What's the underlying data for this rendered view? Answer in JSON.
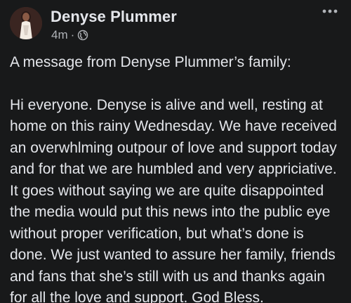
{
  "post": {
    "author_name": "Denyse Plummer",
    "time_ago": "4m",
    "separator": "·",
    "audience_icon": "globe-icon",
    "more_icon": "more-options-icon",
    "intro": "A message from Denyse Plummer’s family:",
    "message": "Hi everyone. Denyse is alive and well, resting at home on this rainy Wednesday. We have received an overwhlming outpour of love and support today and for that we are humbled and very appriciative. It goes without saying we are quite disappointed the media would put this news into the public eye without proper verification, but what’s done is done. We just wanted to assure her family, friends and fans that she’s still with us and thanks again for all the love and support. God Bless."
  },
  "colors": {
    "background": "#18191a",
    "primary_text": "#e4e6eb",
    "secondary_text": "#b0b3b8"
  }
}
